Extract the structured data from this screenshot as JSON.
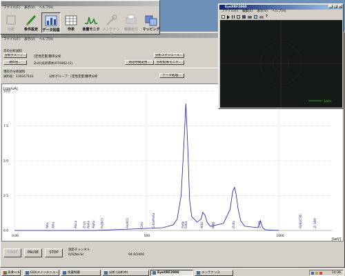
{
  "main_window": {
    "menubar": [
      "ファイル(F)",
      "表示(V)",
      "ヘルプ(H)"
    ],
    "toolbar": [
      {
        "label": "分析",
        "icon": "analysis-icon",
        "enabled": false
      },
      {
        "label": "条件設定",
        "icon": "pencil-icon",
        "enabled": true
      },
      {
        "label": "データ処理",
        "icon": "chart-bars-icon",
        "enabled": true,
        "active": true
      },
      {
        "label": "作表",
        "icon": "table-icon",
        "enabled": true
      },
      {
        "label": "装置モニタ",
        "icon": "spectrum-monitor-icon",
        "enabled": true
      },
      {
        "label": "メンテナンス",
        "icon": "maintenance-icon",
        "enabled": false
      },
      {
        "label": "帳票出力",
        "icon": "report-icon",
        "enabled": false
      },
      {
        "label": "マッピング",
        "icon": "mapping-icon",
        "enabled": true
      }
    ]
  },
  "analysis_panel": {
    "next_sample_heading": "次の分析試料",
    "group_button": "分析グループ...",
    "group_value": "[定性定量]簡単分析",
    "schedule_button": "分析スケジュール...",
    "sample_name_button": "試料名...",
    "sample_name_value": "ZnO(光伝導体)070402-(1)",
    "time_change_button": "測定時間変更...",
    "result_monitor_button": "分析結果モニタ...",
    "current_sample_heading": "現在の分析試料",
    "current_sample_name": "試料名：130317141",
    "current_group": "分析グループ：[定性定量]簡単分析",
    "data_process_button": "データ処理..."
  },
  "chart_data": {
    "type": "line",
    "ylabel": "[cps/uA]",
    "xlabel": "[keV]",
    "xlim": [
      0,
      1000
    ],
    "ylim": [
      0,
      100
    ],
    "xticks": [
      "0.00",
      "500",
      "1000"
    ],
    "yticks": [
      "0.0",
      "2.5",
      "5.0",
      "7.5",
      "10.0"
    ],
    "grid": true,
    "series_color": "#1a1aa8",
    "x": [
      0,
      120,
      300,
      440,
      560,
      600,
      615,
      630,
      640,
      648,
      655,
      662,
      670,
      690,
      705,
      712,
      720,
      728,
      740,
      790,
      815,
      825,
      832,
      838,
      845,
      855,
      870,
      920,
      930,
      938,
      948,
      1000
    ],
    "y": [
      0,
      0,
      0,
      0.1,
      0.2,
      0.4,
      0.8,
      2.5,
      6.0,
      9.1,
      6.0,
      2.2,
      1.0,
      0.6,
      0.8,
      1.3,
      1.1,
      0.6,
      0.3,
      0.5,
      1.5,
      2.8,
      3.1,
      2.6,
      1.6,
      0.7,
      0.3,
      0.2,
      0.7,
      0.2,
      0.05,
      0
    ],
    "peak_labels": [
      {
        "x": 128,
        "text": "-NKα"
      },
      {
        "x": 150,
        "text": "-SiKα"
      },
      {
        "x": 235,
        "text": "-MoLα"
      },
      {
        "x": 268,
        "text": "-ZnLα"
      },
      {
        "x": 283,
        "text": "-NaKα"
      },
      {
        "x": 302,
        "text": "-MgKα"
      },
      {
        "x": 335,
        "text": "-Fe(BiO)"
      },
      {
        "x": 430,
        "text": "-Fe(AlO)"
      },
      {
        "x": 485,
        "text": "-ClKα"
      },
      {
        "x": 530,
        "text": "-CrKa/MnKα"
      },
      {
        "x": 652,
        "text": "-FeKα"
      },
      {
        "x": 640,
        "text": "-FeKβ"
      },
      {
        "x": 712,
        "text": "-NiKα"
      },
      {
        "x": 755,
        "text": "-NiKβ"
      },
      {
        "x": 832,
        "text": "-ZnKα"
      },
      {
        "x": 930,
        "text": "-ZnKβ"
      },
      {
        "x": 1085,
        "text": "-RaKα(CW)"
      },
      {
        "x": 1140,
        "text": "-Zr SKM"
      }
    ]
  },
  "controls": {
    "start_button": "START",
    "pause_button": "PAUSE",
    "stop_button": "STOP",
    "channel_label": "測定チャンネル",
    "channel_value": "D/S[Na-Sc",
    "count_value": "94.9/1000"
  },
  "eye_window": {
    "title": "EyeXRF2000",
    "menubar": [
      "ファイル(F)",
      "編集(E)",
      "表示(V)",
      "ヘルプ(H)"
    ],
    "scale_label": "1mm"
  },
  "taskbar": {
    "start_label": "スタート",
    "tasks": [
      {
        "label": "EDXメインメニュー",
        "active": false
      },
      {
        "label": "装置制御",
        "active": false
      },
      {
        "label": "分析 [分析中]",
        "active": false
      },
      {
        "label": "EyeXRF2000",
        "active": true
      },
      {
        "label": "メンテナンス",
        "active": false
      }
    ],
    "clock": "14:36"
  }
}
